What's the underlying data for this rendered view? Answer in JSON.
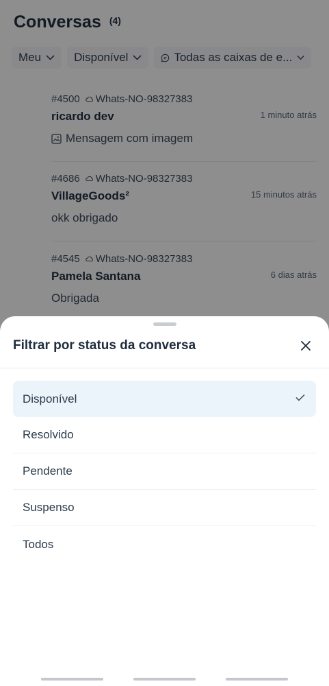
{
  "header": {
    "title": "Conversas",
    "count": "(4)"
  },
  "filters": [
    {
      "label": "Meu",
      "icon": "chevron-down-icon"
    },
    {
      "label": "Disponível",
      "icon": "chevron-down-icon"
    },
    {
      "label": "Todas as caixas de e...",
      "icon": "chat-bubble-icon"
    }
  ],
  "conversations": [
    {
      "id": "#4500",
      "inbox": "Whats-NO-98327383",
      "name": "ricardo dev",
      "time": "1 minuto atrás",
      "message": "Mensagem com imagem",
      "has_image_icon": true
    },
    {
      "id": "#4686",
      "inbox": "Whats-NO-98327383",
      "name": "VillageGoods²",
      "time": "15 minutos atrás",
      "message": "okk obrigado",
      "has_image_icon": false
    },
    {
      "id": "#4545",
      "inbox": "Whats-NO-98327383",
      "name": "Pamela Santana",
      "time": "6 dias atrás",
      "message": "Obrigada",
      "has_image_icon": false
    }
  ],
  "sheet": {
    "title": "Filtrar por status da conversa",
    "options": [
      {
        "label": "Disponível",
        "selected": true
      },
      {
        "label": "Resolvido",
        "selected": false
      },
      {
        "label": "Pendente",
        "selected": false
      },
      {
        "label": "Suspenso",
        "selected": false
      },
      {
        "label": "Todos",
        "selected": false
      }
    ]
  },
  "colors": {
    "selected_bg": "#ebf3fb",
    "text": "#1f2d3d",
    "overlay": "#000000"
  }
}
